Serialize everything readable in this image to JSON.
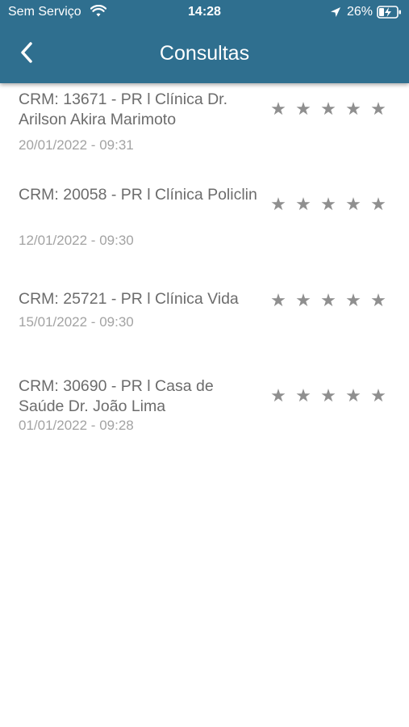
{
  "status_bar": {
    "carrier": "Sem Serviço",
    "time": "14:28",
    "battery": "26%",
    "icons": [
      "wifi-icon",
      "location-arrow-icon",
      "battery-charging-icon"
    ]
  },
  "header": {
    "title": "Consultas",
    "back_icon": "chevron-left-icon",
    "background": "#2f6f8f"
  },
  "consultas": [
    {
      "title": "CRM: 13671 - PR l Clínica Dr. Arilson Akira Marimoto",
      "date": "20/01/2022 - 09:31",
      "rating": 0
    },
    {
      "title": "CRM: 20058 - PR l Clínica Policlin",
      "date": "12/01/2022 - 09:30",
      "rating": 0
    },
    {
      "title": "CRM: 25721 - PR l Clínica Vida",
      "date": "15/01/2022 - 09:30",
      "rating": 0
    },
    {
      "title": "CRM: 30690 - PR l Casa de Saúde Dr. João Lima",
      "date": "01/01/2022 - 09:28",
      "rating": 0
    }
  ],
  "star_icon": "star-icon",
  "stars_per_item": 5
}
